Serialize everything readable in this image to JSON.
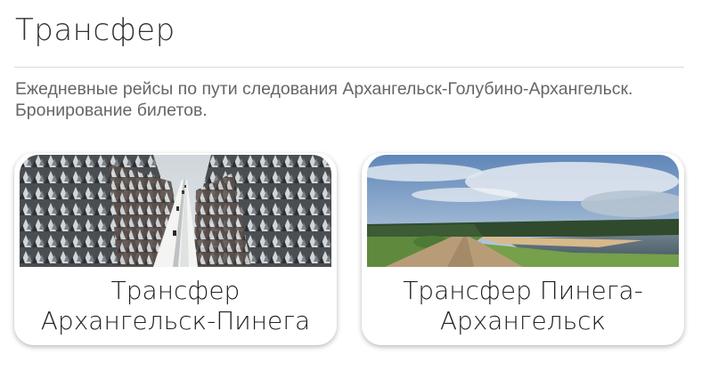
{
  "page": {
    "title": "Трансфер",
    "description": "Ежедневные рейсы по пути следования Архангельск-Голубино-Архангельск. Бронирование билетов."
  },
  "cards": [
    {
      "label_line1": "Трансфер",
      "label_line2": "Архангельск-Пинега"
    },
    {
      "label_line1": "Трансфер Пинега-",
      "label_line2": "Архангельск"
    }
  ],
  "colors": {
    "title_text": "#333333",
    "description_text": "#666666",
    "divider": "#dcdcdc",
    "card_background": "#ffffff"
  }
}
